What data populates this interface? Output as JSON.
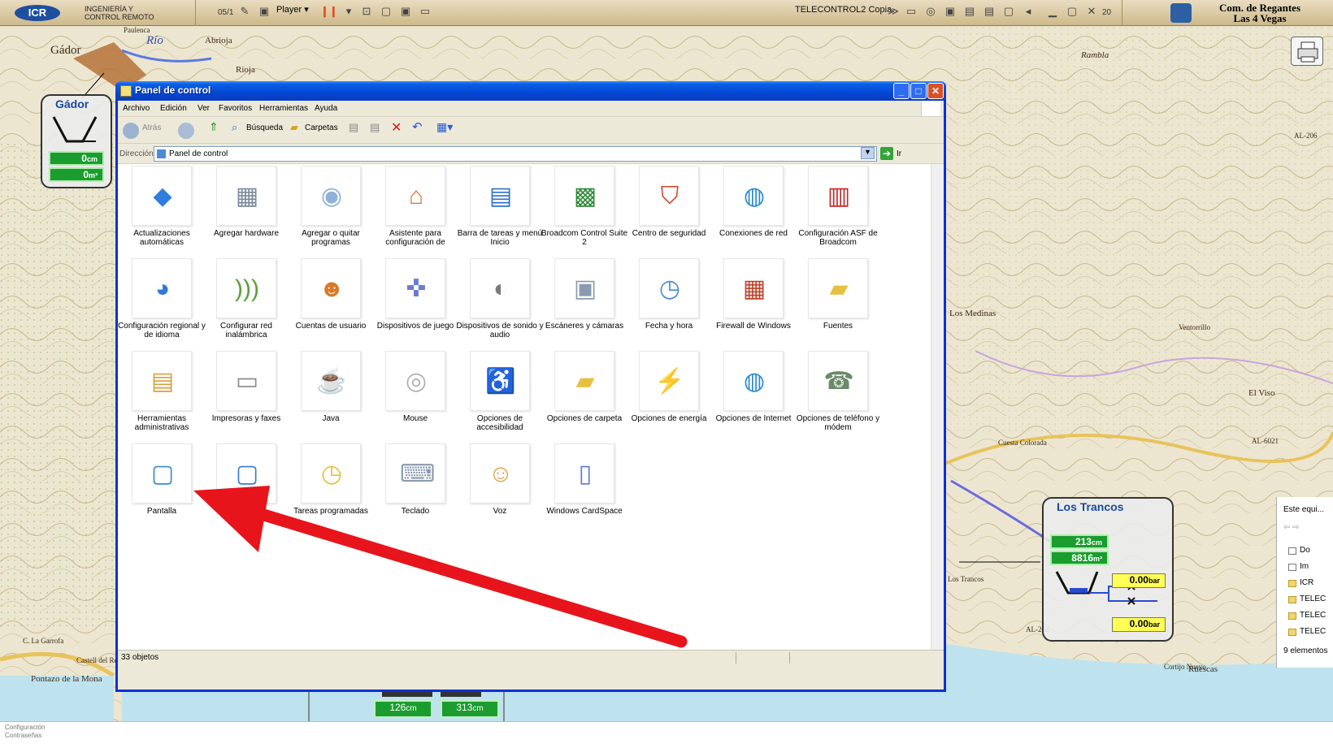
{
  "topbar": {
    "company": "INGENIERÍA Y\nCONTROL REMOTO",
    "logo": "ICR",
    "date": "05/1",
    "player_label": "Player",
    "window_title": "TELECONTROL2 Copia",
    "number": "20",
    "organization": "Com. de Regantes\nLas 4 Vegas"
  },
  "map": {
    "labels": [
      {
        "text": "Gádor",
        "cls": "big"
      },
      {
        "text": "Paulenca",
        "cls": "small"
      },
      {
        "text": "Río",
        "cls": "big"
      },
      {
        "text": "Abrioja",
        "cls": ""
      },
      {
        "text": "Rioja",
        "cls": ""
      },
      {
        "text": "Los Medinas",
        "cls": ""
      },
      {
        "text": "El Viso",
        "cls": ""
      },
      {
        "text": "Cuesta Colorada",
        "cls": "small"
      },
      {
        "text": "Ventorrillo",
        "cls": "small"
      },
      {
        "text": "Cortijo Nuevo",
        "cls": "small"
      },
      {
        "text": "Ruescas",
        "cls": ""
      },
      {
        "text": "Pontazo de la Mona",
        "cls": ""
      },
      {
        "text": "C. La Garrofa",
        "cls": "small"
      },
      {
        "text": "Castell del Rey",
        "cls": "small"
      },
      {
        "text": "AL-206",
        "cls": "small"
      },
      {
        "text": "AL-6021",
        "cls": "small"
      },
      {
        "text": "AL-202",
        "cls": "small"
      },
      {
        "text": "Rambla",
        "cls": ""
      },
      {
        "text": "Los Trancos",
        "cls": "small"
      }
    ]
  },
  "stations": {
    "gador": {
      "title": "Gádor",
      "level": "0",
      "level_unit": "cm",
      "volume": "0",
      "volume_unit": "m³"
    },
    "trancos": {
      "title": "Los Trancos",
      "level": "213",
      "level_unit": "cm",
      "volume": "8816",
      "volume_unit": "m³",
      "pressure1": "0.00",
      "pressure2": "0.00",
      "pressure_unit": "bar"
    },
    "bottom": [
      {
        "value": "126",
        "unit": "cm"
      },
      {
        "value": "313",
        "unit": "cm"
      }
    ]
  },
  "sidepane": {
    "top": "Este equi...",
    "items": [
      "Do",
      "Im",
      "ICR",
      "TELEC",
      "TELEC",
      "TELEC"
    ],
    "count": "9 elementos"
  },
  "bottomstrip": {
    "text": "Configuración\nContraseñas"
  },
  "window": {
    "title": "Panel de control",
    "menu": [
      "Archivo",
      "Edición",
      "Ver",
      "Favoritos",
      "Herramientas",
      "Ayuda"
    ],
    "toolbar": {
      "back": "Atrás",
      "search": "Búsqueda",
      "folders": "Carpetas"
    },
    "address_label": "Dirección",
    "address": "Panel de control",
    "go": "Ir",
    "status": "33 objetos",
    "items": [
      {
        "label": "Actualizaciones automáticas",
        "icon": "windows-update-icon",
        "glyph": "◆",
        "color": "#2f7de0"
      },
      {
        "label": "Agregar hardware",
        "icon": "hardware-icon",
        "glyph": "▦",
        "color": "#7a8a9c"
      },
      {
        "label": "Agregar o quitar programas",
        "icon": "programs-icon",
        "glyph": "◉",
        "color": "#8fb0d8"
      },
      {
        "label": "Asistente para configuración de",
        "icon": "home-network-icon",
        "glyph": "⌂",
        "color": "#e07030"
      },
      {
        "label": "Barra de tareas y menú Inicio",
        "icon": "taskbar-icon",
        "glyph": "▤",
        "color": "#2f6fd0"
      },
      {
        "label": "Broadcom Control Suite 2",
        "icon": "broadcom-icon",
        "glyph": "▩",
        "color": "#2e8a3a"
      },
      {
        "label": "Centro de seguridad",
        "icon": "security-shield-icon",
        "glyph": "⛉",
        "color": "#d0402a"
      },
      {
        "label": "Conexiones de red",
        "icon": "network-globe-icon",
        "glyph": "◍",
        "color": "#2a8ad0"
      },
      {
        "label": "Configuración ASF de Broadcom",
        "icon": "asf-icon",
        "glyph": "▥",
        "color": "#c02a2a"
      },
      {
        "label": "Configuración regional y de idioma",
        "icon": "globe-icon",
        "glyph": "◕",
        "color": "#2f7ad8"
      },
      {
        "label": "Configurar red inalámbrica",
        "icon": "wireless-icon",
        "glyph": ")))",
        "color": "#5aa03a"
      },
      {
        "label": "Cuentas de usuario",
        "icon": "users-icon",
        "glyph": "☻",
        "color": "#d87a2a"
      },
      {
        "label": "Dispositivos de juego",
        "icon": "gamepad-icon",
        "glyph": "✜",
        "color": "#6a7ad0"
      },
      {
        "label": "Dispositivos de sonido y audio",
        "icon": "speaker-icon",
        "glyph": "◐",
        "color": "#7a7a7a"
      },
      {
        "label": "Escáneres y cámaras",
        "icon": "scanner-icon",
        "glyph": "▣",
        "color": "#8a9ab0"
      },
      {
        "label": "Fecha y hora",
        "icon": "clock-icon",
        "glyph": "◷",
        "color": "#4a8ad8"
      },
      {
        "label": "Firewall de Windows",
        "icon": "firewall-icon",
        "glyph": "▦",
        "color": "#c0432a"
      },
      {
        "label": "Fuentes",
        "icon": "fonts-folder-icon",
        "glyph": "▰",
        "color": "#e8c040"
      },
      {
        "label": "Herramientas administrativas",
        "icon": "admin-tools-icon",
        "glyph": "▤",
        "color": "#d8a040"
      },
      {
        "label": "Impresoras y faxes",
        "icon": "printer-icon",
        "glyph": "▭",
        "color": "#8a8a8a"
      },
      {
        "label": "Java",
        "icon": "java-icon",
        "glyph": "☕",
        "color": "#4a7ac0"
      },
      {
        "label": "Mouse",
        "icon": "mouse-icon",
        "glyph": "◎",
        "color": "#b0b0b0"
      },
      {
        "label": "Opciones de accesibilidad",
        "icon": "accessibility-icon",
        "glyph": "♿",
        "color": "#2a9a3a"
      },
      {
        "label": "Opciones de carpeta",
        "icon": "folder-options-icon",
        "glyph": "▰",
        "color": "#e8c040"
      },
      {
        "label": "Opciones de energía",
        "icon": "power-icon",
        "glyph": "⚡",
        "color": "#8a9ab8"
      },
      {
        "label": "Opciones de Internet",
        "icon": "internet-icon",
        "glyph": "◍",
        "color": "#2a8ad0"
      },
      {
        "label": "Opciones de teléfono y módem",
        "icon": "phone-icon",
        "glyph": "☎",
        "color": "#6a8a6a"
      },
      {
        "label": "Pantalla",
        "icon": "display-icon",
        "glyph": "▢",
        "color": "#3a8ad0"
      },
      {
        "label": "",
        "icon": "monitor-check-icon",
        "glyph": "▢",
        "color": "#3a7ad0"
      },
      {
        "label": "Tareas programadas",
        "icon": "scheduled-tasks-icon",
        "glyph": "◷",
        "color": "#e8c040"
      },
      {
        "label": "Teclado",
        "icon": "keyboard-icon",
        "glyph": "⌨",
        "color": "#8a9ab0"
      },
      {
        "label": "Voz",
        "icon": "speech-icon",
        "glyph": "☺",
        "color": "#d8a040"
      },
      {
        "label": "Windows CardSpace",
        "icon": "cardspace-icon",
        "glyph": "▯",
        "color": "#5a7ad0"
      }
    ]
  },
  "arrow": {
    "color": "#e8141c",
    "target": "Pantalla"
  }
}
